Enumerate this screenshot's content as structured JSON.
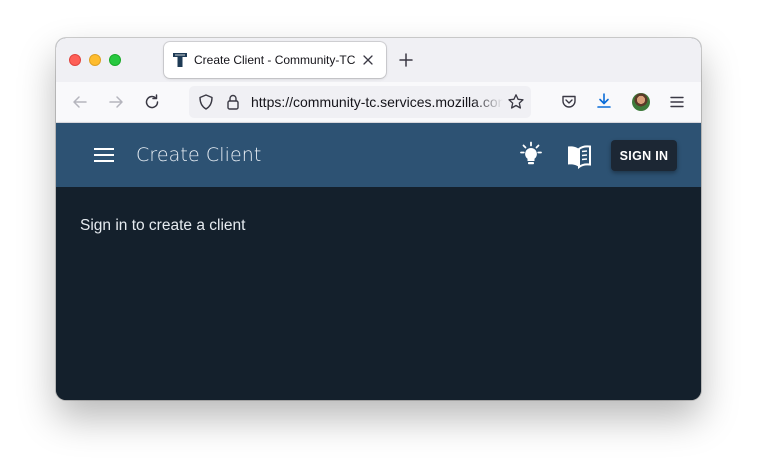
{
  "browser": {
    "tab": {
      "title": "Create Client - Community-TC",
      "favicon": "taskcluster-t-icon"
    },
    "url": "https://community-tc.services.mozilla.com/auth/clients/create"
  },
  "app": {
    "title": "Create Client",
    "signin_label": "SIGN IN",
    "colors": {
      "appbar": "#2d5273",
      "content": "#14202c",
      "button": "#1c2734"
    }
  },
  "content": {
    "message": "Sign in to create a client"
  }
}
